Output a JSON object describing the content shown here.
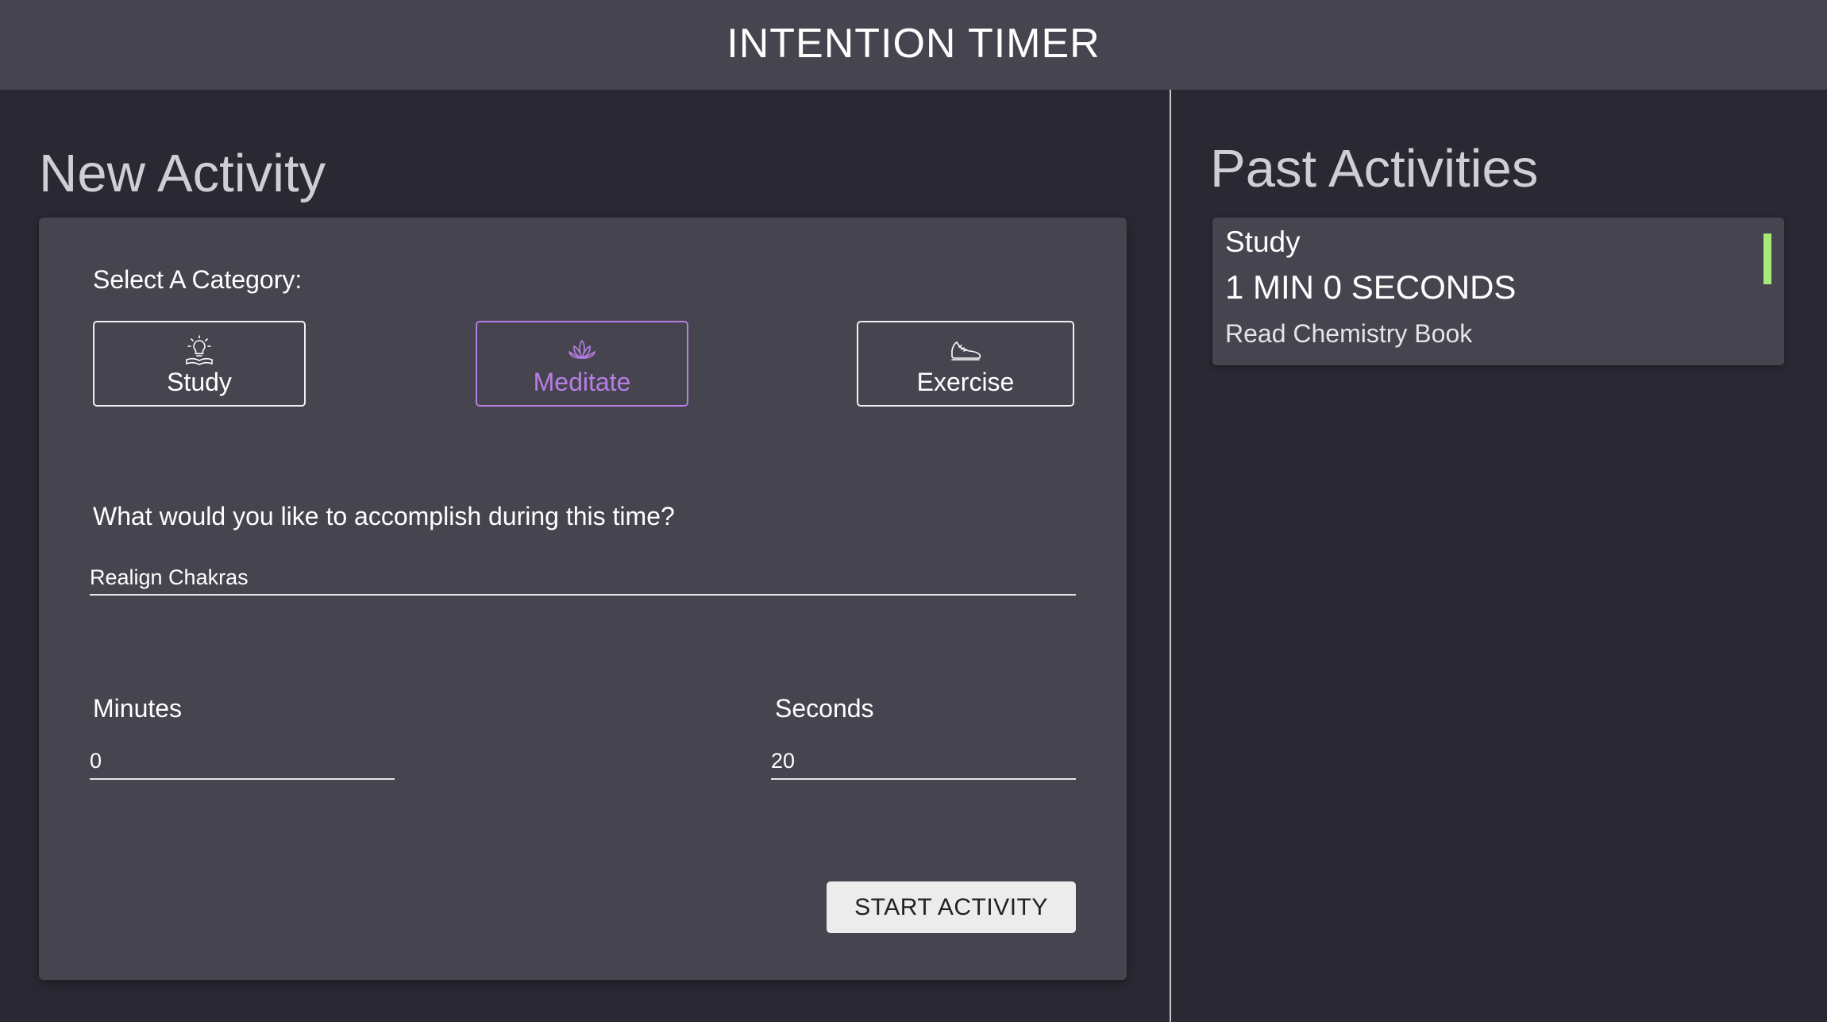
{
  "header": {
    "title": "INTENTION TIMER"
  },
  "new_activity": {
    "title": "New Activity",
    "category_prompt": "Select A Category:",
    "categories": [
      {
        "label": "Study",
        "icon": "lightbulb-book-icon",
        "selected": false
      },
      {
        "label": "Meditate",
        "icon": "lotus-icon",
        "selected": true
      },
      {
        "label": "Exercise",
        "icon": "sneaker-icon",
        "selected": false
      }
    ],
    "description_prompt": "What would you like to accomplish during this time?",
    "description_value": "Realign Chakras",
    "minutes_label": "Minutes",
    "minutes_value": "0",
    "seconds_label": "Seconds",
    "seconds_value": "20",
    "start_button": "START ACTIVITY"
  },
  "past_activities": {
    "title": "Past Activities",
    "items": [
      {
        "category": "Study",
        "duration": "1 MIN 0 SECONDS",
        "description": "Read Chemistry Book",
        "indicator_color": "#a6ea7a"
      }
    ]
  },
  "colors": {
    "header_bg": "#46444f",
    "page_bg": "#2a2833",
    "card_bg": "#46444f",
    "meditate_accent": "#b77ee6",
    "study_accent": "#a6ea7a"
  }
}
